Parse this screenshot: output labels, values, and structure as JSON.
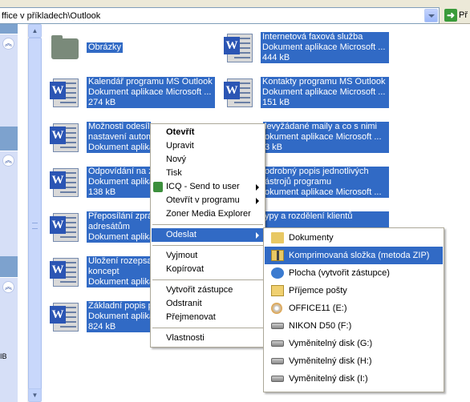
{
  "address_bar": {
    "path": "ffice v příkladech\\Outlook",
    "go_label": "Př"
  },
  "task_pane": {
    "note": "IB"
  },
  "files": [
    {
      "name_line1": "Obrázky",
      "name_line2": "",
      "name_line3": "",
      "type": "folder"
    },
    {
      "name_line1": "Internetová faxová služba",
      "name_line2": "Dokument aplikace Microsoft ...",
      "name_line3": "444 kB",
      "type": "word"
    },
    {
      "name_line1": "Kalendář programu MS Outlook",
      "name_line2": "Dokument aplikace Microsoft ...",
      "name_line3": "274 kB",
      "type": "word"
    },
    {
      "name_line1": "Kontakty programu MS Outlook",
      "name_line2": "Dokument aplikace Microsoft ...",
      "name_line3": "151 kB",
      "type": "word"
    },
    {
      "name_line1": "Možnosti odesíl",
      "name_line2": "nastavení autom",
      "name_line3": "Dokument aplika",
      "type": "word"
    },
    {
      "name_line1": "levyžádané maily a co s nimi",
      "name_line2": "okument aplikace Microsoft ...",
      "name_line3": "3 kB",
      "type": "word"
    },
    {
      "name_line1": "Odpovídání na z",
      "name_line2": "Dokument aplika",
      "name_line3": "138 kB",
      "type": "word"
    },
    {
      "name_line1": "odrobný popis jednotlivých",
      "name_line2": "ástrojů programu",
      "name_line3": "okument aplikace Microsoft ...",
      "type": "word"
    },
    {
      "name_line1": "Přeposílání zprá",
      "name_line2": "adresátům",
      "name_line3": "Dokument aplika",
      "type": "word"
    },
    {
      "name_line1": "ypy a rozdělení klientů",
      "name_line2": "",
      "name_line3": "",
      "type": "word"
    },
    {
      "name_line1": "Uložení rozepsan",
      "name_line2": "koncept",
      "name_line3": "Dokument aplika",
      "type": "word"
    },
    {
      "name_line1": "Základní popis p",
      "name_line2": "Dokument aplika",
      "name_line3": "824 kB",
      "type": "word"
    }
  ],
  "context_menu": {
    "items": [
      {
        "label": "Otevřít",
        "bold": true
      },
      {
        "label": "Upravit"
      },
      {
        "label": "Nový"
      },
      {
        "label": "Tisk"
      },
      {
        "label": "ICQ - Send to user",
        "arrow": true
      },
      {
        "label": "Otevřít v programu",
        "arrow": true
      },
      {
        "label": "Zoner Media Explorer"
      },
      {
        "label": "Odeslat",
        "arrow": true
      },
      {
        "label": "Vyjmout"
      },
      {
        "label": "Kopírovat"
      },
      {
        "label": "Vytvořit zástupce"
      },
      {
        "label": "Odstranit"
      },
      {
        "label": "Přejmenovat"
      },
      {
        "label": "Vlastnosti"
      }
    ]
  },
  "send_to_menu": {
    "items": [
      {
        "label": "Dokumenty",
        "icon": "folder-icon"
      },
      {
        "label": "Komprimovaná složka (metoda ZIP)",
        "icon": "zip-folder-icon"
      },
      {
        "label": "Plocha (vytvořit zástupce)",
        "icon": "desktop-icon"
      },
      {
        "label": "Příjemce pošty",
        "icon": "mail-icon"
      },
      {
        "label": "OFFICE11 (E:)",
        "icon": "cd-icon"
      },
      {
        "label": "NIKON D50 (F:)",
        "icon": "drive-icon"
      },
      {
        "label": "Vyměnitelný disk (G:)",
        "icon": "drive-icon"
      },
      {
        "label": "Vyměnitelný disk (H:)",
        "icon": "drive-icon"
      },
      {
        "label": "Vyměnitelný disk (I:)",
        "icon": "drive-icon"
      }
    ]
  },
  "colors": {
    "selection": "#316ac5",
    "toolbar": "#ece9d8",
    "task_pane": "#7da2ce"
  }
}
